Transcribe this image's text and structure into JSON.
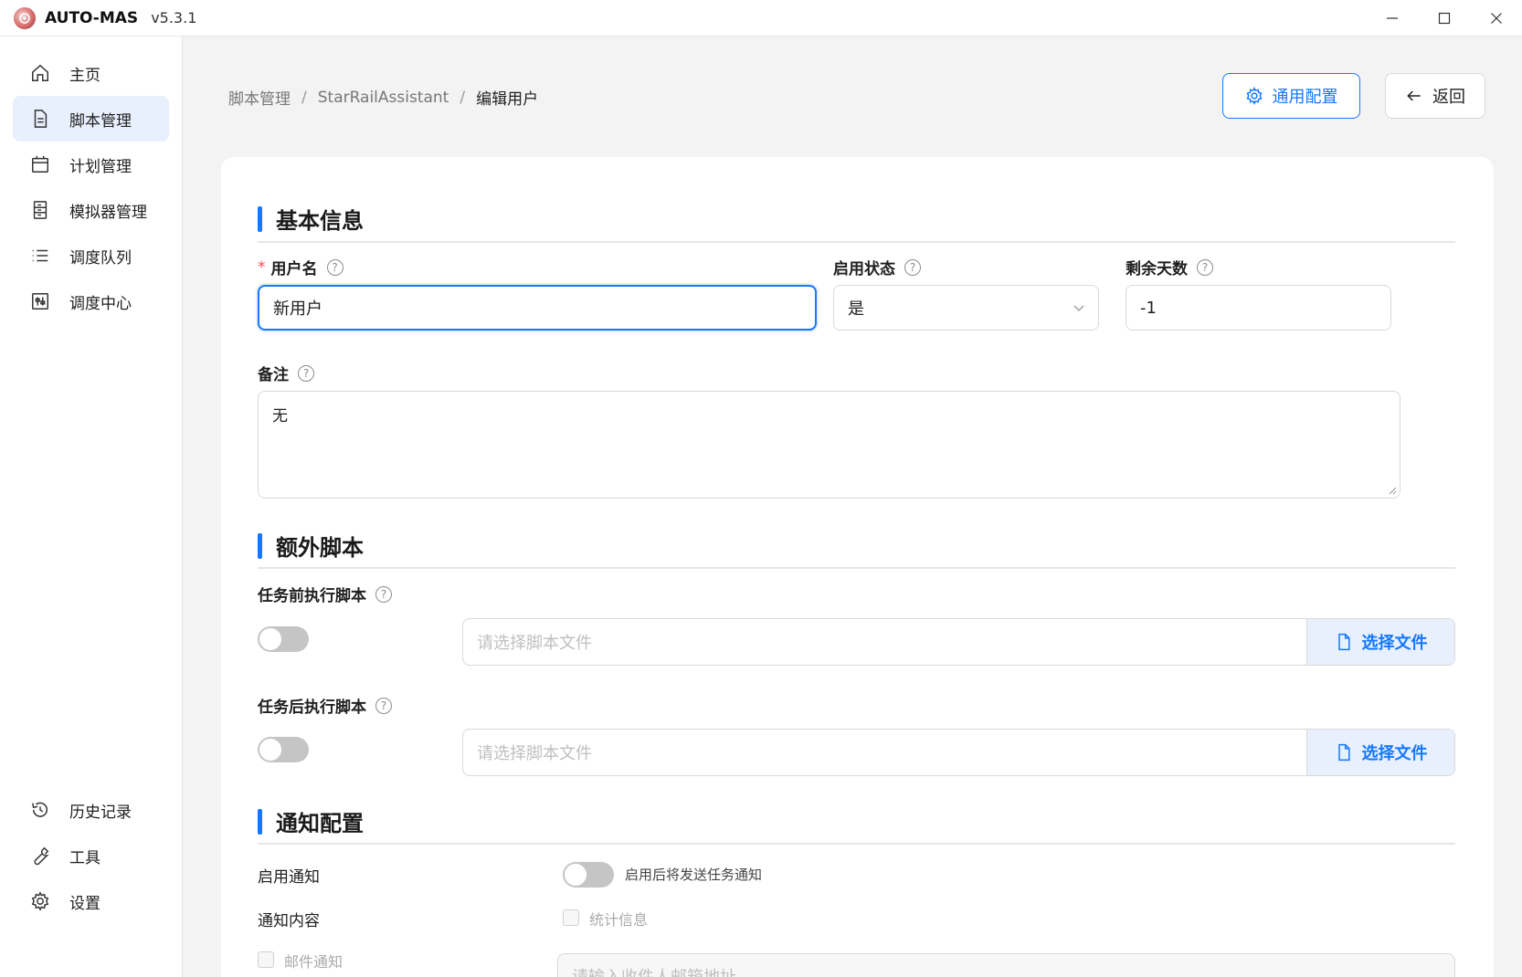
{
  "app": {
    "name": "AUTO-MAS",
    "version": "v5.3.1"
  },
  "sidebar": {
    "items": [
      {
        "label": "主页",
        "icon": "home-icon"
      },
      {
        "label": "脚本管理",
        "icon": "file-icon",
        "active": true
      },
      {
        "label": "计划管理",
        "icon": "calendar-icon"
      },
      {
        "label": "模拟器管理",
        "icon": "server-icon"
      },
      {
        "label": "调度队列",
        "icon": "list-icon"
      },
      {
        "label": "调度中心",
        "icon": "sliders-icon"
      }
    ],
    "bottom_items": [
      {
        "label": "历史记录",
        "icon": "history-icon"
      },
      {
        "label": "工具",
        "icon": "wrench-icon"
      },
      {
        "label": "设置",
        "icon": "gear-icon"
      }
    ]
  },
  "breadcrumb": {
    "items": [
      "脚本管理",
      "StarRailAssistant",
      "编辑用户"
    ],
    "separator": "/"
  },
  "toolbar": {
    "general_config_label": "通用配置",
    "back_label": "返回"
  },
  "basic_info": {
    "title": "基本信息",
    "username_label": "用户名",
    "username_value": "新用户",
    "status_label": "启用状态",
    "status_value": "是",
    "days_label": "剩余天数",
    "days_value": "-1",
    "note_label": "备注",
    "note_value": "无"
  },
  "extra_scripts": {
    "title": "额外脚本",
    "pre_label": "任务前执行脚本",
    "post_label": "任务后执行脚本",
    "placeholder": "请选择脚本文件",
    "choose_file_label": "选择文件"
  },
  "notify": {
    "title": "通知配置",
    "enable_label": "启用通知",
    "enable_hint": "启用后将发送任务通知",
    "content_label": "通知内容",
    "stats_label": "统计信息",
    "email_label": "邮件通知",
    "email_placeholder": "请输入收件人邮箱地址"
  },
  "colors": {
    "accent": "#1677ff",
    "active_nav_bg": "#e8f0fe",
    "required": "#ff4d4f"
  }
}
